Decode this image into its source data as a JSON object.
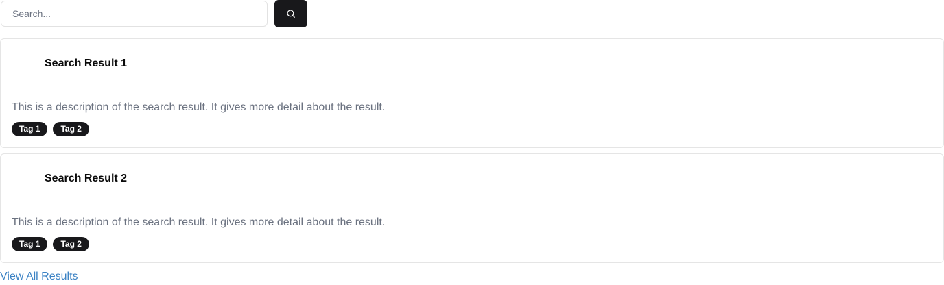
{
  "search": {
    "placeholder": "Search...",
    "value": "",
    "button_icon": "search-icon"
  },
  "results": [
    {
      "title": "Search Result 1",
      "description": "This is a description of the search result. It gives more detail about the result.",
      "tags": [
        "Tag 1",
        "Tag 2"
      ]
    },
    {
      "title": "Search Result 2",
      "description": "This is a description of the search result. It gives more detail about the result.",
      "tags": [
        "Tag 1",
        "Tag 2"
      ]
    }
  ],
  "footer": {
    "view_all_label": "View All Results"
  },
  "colors": {
    "button_bg": "#18181b",
    "tag_bg": "#18181b",
    "link": "#3b82c4",
    "description": "#6b7280",
    "border": "#e5e5e5"
  }
}
